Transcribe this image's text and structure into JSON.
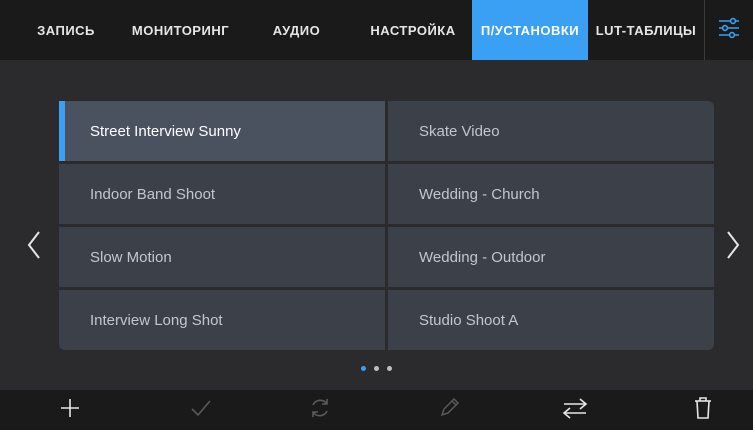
{
  "tabs": [
    {
      "label": "ЗАПИСЬ",
      "active": false
    },
    {
      "label": "МОНИТОРИНГ",
      "active": false
    },
    {
      "label": "АУДИО",
      "active": false
    },
    {
      "label": "НАСТРОЙКА",
      "active": false
    },
    {
      "label": "П/УСТАНОВКИ",
      "active": true
    },
    {
      "label": "LUT-ТАБЛИЦЫ",
      "active": false
    }
  ],
  "settings_icon": "sliders-icon",
  "presets": [
    {
      "label": "Street Interview Sunny",
      "selected": true
    },
    {
      "label": "Skate Video",
      "selected": false
    },
    {
      "label": "Indoor Band Shoot",
      "selected": false
    },
    {
      "label": "Wedding  - Church",
      "selected": false
    },
    {
      "label": "Slow Motion",
      "selected": false
    },
    {
      "label": "Wedding - Outdoor",
      "selected": false
    },
    {
      "label": "Interview Long Shot",
      "selected": false
    },
    {
      "label": "Studio Shoot A",
      "selected": false
    }
  ],
  "pagination": {
    "total": 3,
    "current": 1
  },
  "toolbar": {
    "icons": [
      "add-icon",
      "apply-checkmark-icon",
      "update-refresh-icon",
      "rename-pencil-icon",
      "import-export-icon",
      "delete-trash-icon"
    ]
  },
  "colors": {
    "accent": "#3aa0f3",
    "tile": "#3b4049",
    "tile_selected": "#4a5260",
    "background": "#2b2b2e",
    "bar": "#1a1a1a"
  }
}
